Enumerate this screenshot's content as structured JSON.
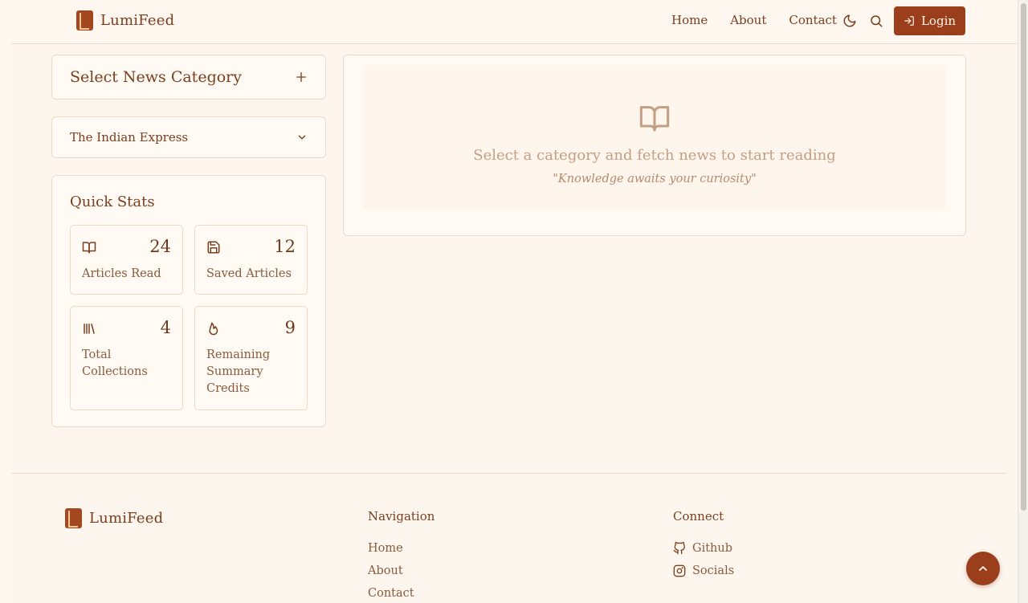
{
  "header": {
    "brand": "LumiFeed",
    "nav": [
      "Home",
      "About",
      "Contact"
    ],
    "login_label": "Login"
  },
  "sidebar": {
    "category_title": "Select News Category",
    "source_selected": "The Indian Express",
    "stats_title": "Quick Stats",
    "stats": [
      {
        "value": "24",
        "label": "Articles Read",
        "icon": "book-open-icon"
      },
      {
        "value": "12",
        "label": "Saved Articles",
        "icon": "save-icon"
      },
      {
        "value": "4",
        "label": "Total Collections",
        "icon": "library-icon"
      },
      {
        "value": "9",
        "label": "Remaining Summary Credits",
        "icon": "flame-icon"
      }
    ]
  },
  "main": {
    "empty_title": "Select a category and fetch news to start reading",
    "empty_quote": "\"Knowledge awaits your curiosity\""
  },
  "footer": {
    "brand": "LumiFeed",
    "nav_heading": "Navigation",
    "nav_links": [
      "Home",
      "About",
      "Contact"
    ],
    "connect_heading": "Connect",
    "connect_links": [
      "Github",
      "Socials"
    ]
  },
  "colors": {
    "accent": "#9a3e1b",
    "background": "#fdf6ee",
    "text": "#7a3e1d"
  }
}
